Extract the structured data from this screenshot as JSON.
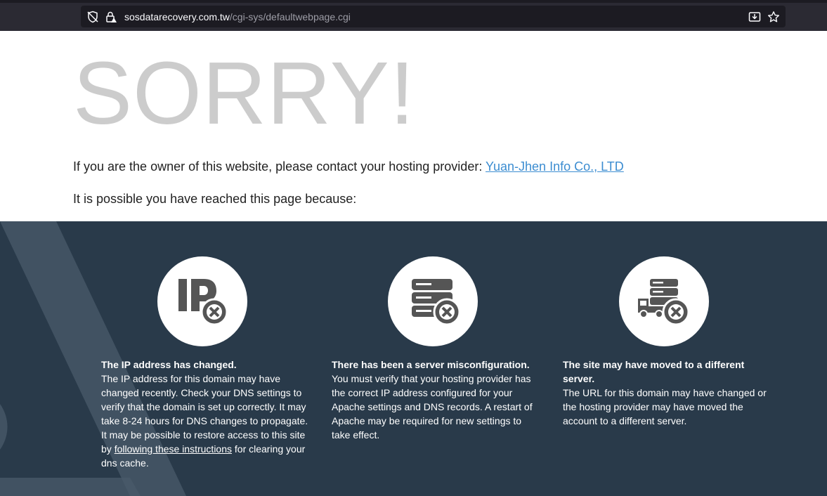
{
  "browser": {
    "url_domain": "sosdatarecovery.com.tw",
    "url_path": "/cgi-sys/defaultwebpage.cgi"
  },
  "page": {
    "heading": "SORRY!",
    "owner_text": "If you are the owner of this website, please contact your hosting provider: ",
    "provider_link": "Yuan-Jhen Info Co., LTD",
    "reason_intro": "It is possible you have reached this page because:"
  },
  "reasons": [
    {
      "icon": "ip-error-icon",
      "title": "The IP address has changed.",
      "body": "The IP address for this domain may have changed recently. Check your DNS settings to verify that the domain is set up correctly. It may take 8-24 hours for DNS changes to propagate. It may be possible to restore access to this site by ",
      "link": "following these instructions",
      "tail": " for clearing your dns cache."
    },
    {
      "icon": "server-error-icon",
      "title": "There has been a server misconfiguration.",
      "body": "You must verify that your hosting provider has the correct IP address configured for your Apache settings and DNS records. A restart of Apache may be required for new settings to take effect."
    },
    {
      "icon": "moved-server-icon",
      "title": "The site may have moved to a different server.",
      "body": "The URL for this domain may have changed or the hosting provider may have moved the account to a different server."
    }
  ]
}
